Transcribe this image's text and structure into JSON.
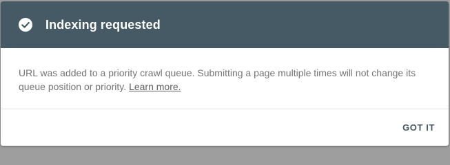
{
  "dialog": {
    "title": "Indexing requested",
    "status_icon": "check-circle-icon",
    "message": "URL was added to a priority crawl queue. Submitting a page multiple times will not change its queue position or priority.",
    "learn_more_label": "Learn more.",
    "action_label": "GOT IT"
  },
  "colors": {
    "header_background": "#455a64",
    "message_text": "#757575",
    "button_text": "#455a64"
  }
}
